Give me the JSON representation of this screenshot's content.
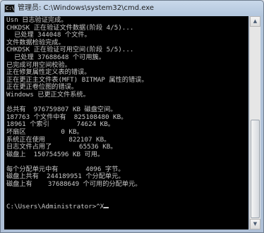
{
  "window": {
    "title": "管理员: C:\\Windows\\system32\\cmd.exe",
    "icon": "cmd-window-icon",
    "icon_glyph": "C:\\"
  },
  "console": {
    "text_color": "#c8c8c8",
    "background": "#000000",
    "lines": [
      "Usn 日志验证完成。",
      "CHKDSK 正在验证文件数据(阶段 4/5)...",
      "  已处理 344048 个文件。",
      "文件数据检验完成。",
      "CHKDSK 正在验证可用空间(阶段 5/5)...",
      "  已处理 37688648 个可用簇。",
      "已完成可用空间校验。",
      "正在修复属性定义表的错误。",
      "正在更正主文件表(MFT) BITMAP 属性的错误。",
      "正在更正卷位图的错误。",
      "Windows 已更正文件系统。",
      "",
      "总共有  976759807 KB 磁盘空间。",
      "187763 个文件中有  825108480 KB。",
      "18961 个索引       74624 KB。",
      "坏扇区         0 KB。",
      "系统正在使用      822107 KB。",
      "日志文件占用了       65536 KB。",
      "磁盘上  150754596 KB 可用。",
      "",
      "每个分配单元中有       4096 字节。",
      "磁盘上共有  244189951 个分配单元。",
      "磁盘上有    37688649 个可用的分配单元。",
      "",
      "",
      "C:\\Users\\Administrator>^X"
    ]
  }
}
